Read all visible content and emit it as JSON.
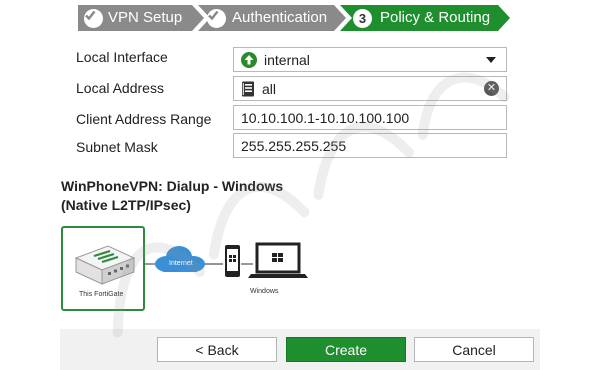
{
  "wizard": {
    "steps": [
      {
        "label": "VPN Setup",
        "state": "done",
        "icon": "check-icon"
      },
      {
        "label": "Authentication",
        "state": "done",
        "icon": "check-icon"
      },
      {
        "label": "Policy & Routing",
        "state": "active",
        "number": "3"
      }
    ]
  },
  "form": {
    "local_interface": {
      "label": "Local Interface",
      "value": "internal",
      "icon": "up-arrow-circle-icon"
    },
    "local_address": {
      "label": "Local Address",
      "value": "all",
      "icon": "address-book-icon"
    },
    "client_address_range": {
      "label": "Client Address Range",
      "value": "10.10.100.1-10.10.100.100"
    },
    "subnet_mask": {
      "label": "Subnet Mask",
      "value": "255.255.255.255"
    }
  },
  "summary": {
    "line1": "WinPhoneVPN: Dialup - Windows",
    "line2": "(Native L2TP/IPsec)"
  },
  "diagram": {
    "fortigate_label": "This FortiGate",
    "cloud_label": "Internet",
    "client_label": "Windows"
  },
  "buttons": {
    "back": "< Back",
    "create": "Create",
    "cancel": "Cancel"
  },
  "colors": {
    "accent_green": "#1e8e2e",
    "step_done": "#8a8a8a",
    "step_active": "#1e8e2e",
    "cloud_blue": "#3b8fd6"
  }
}
